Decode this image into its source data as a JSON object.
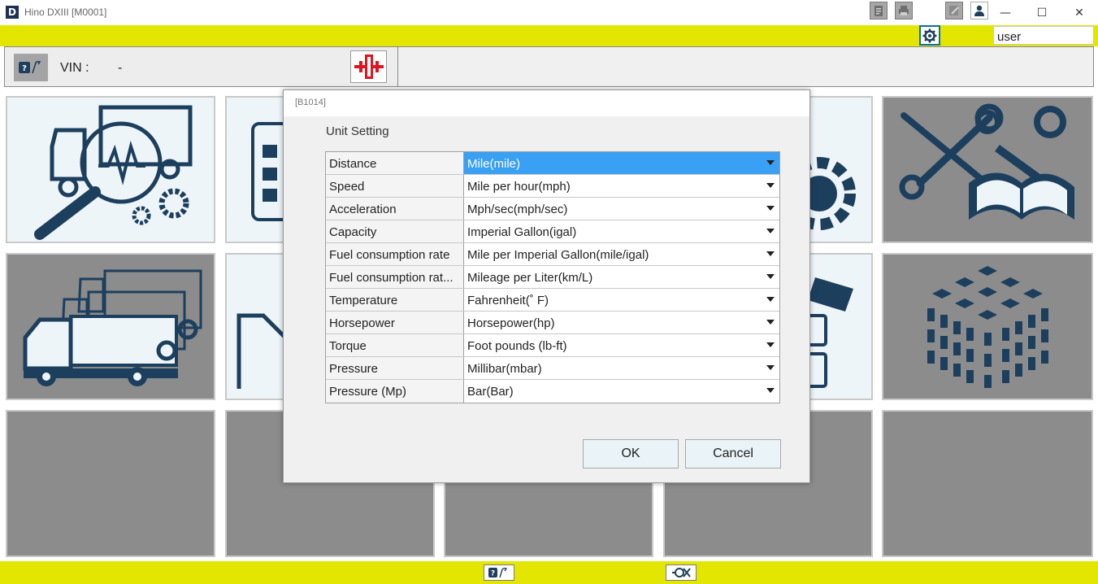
{
  "window": {
    "app_icon_letter": "D",
    "title": "Hino DXIII [M0001]",
    "minimize_glyph": "—",
    "maximize_glyph": "☐",
    "close_glyph": "✕"
  },
  "toolbar": {
    "icons": [
      "clipboard-icon",
      "printer-icon",
      "gear-icon",
      "edit-icon",
      "user-icon"
    ],
    "active_icon": "gear-icon",
    "user_value": "user"
  },
  "vehicle": {
    "vin_label": "VIN :",
    "vin_value": "-"
  },
  "colors": {
    "accent_yellow": "#e3e600",
    "tile_dark": "#8c8c8c",
    "tile_light": "#eef5f8",
    "icon_navy": "#1d3f5e",
    "selected_blue": "#3aa0f3",
    "connect_red": "#e0141e"
  },
  "dialog": {
    "code": "[B1014]",
    "title": "Unit Setting",
    "rows": [
      {
        "label": "Distance",
        "value": "Mile(mile)"
      },
      {
        "label": "Speed",
        "value": "Mile per hour(mph)"
      },
      {
        "label": "Acceleration",
        "value": "Mph/sec(mph/sec)"
      },
      {
        "label": "Capacity",
        "value": "Imperial Gallon(igal)"
      },
      {
        "label": "Fuel consumption rate",
        "value": "Mile per Imperial Gallon(mile/igal)"
      },
      {
        "label": "Fuel consumption rat...",
        "value": "Mileage per Liter(km/L)"
      },
      {
        "label": "Temperature",
        "value": "Fahrenheit(˚ F)"
      },
      {
        "label": "Horsepower",
        "value": "Horsepower(hp)"
      },
      {
        "label": "Torque",
        "value": "Foot pounds (lb-ft)"
      },
      {
        "label": "Pressure",
        "value": "Millibar(mbar)"
      },
      {
        "label": "Pressure (Mp)",
        "value": "Bar(Bar)"
      }
    ],
    "selected_row": "Distance",
    "ok_label": "OK",
    "cancel_label": "Cancel"
  }
}
